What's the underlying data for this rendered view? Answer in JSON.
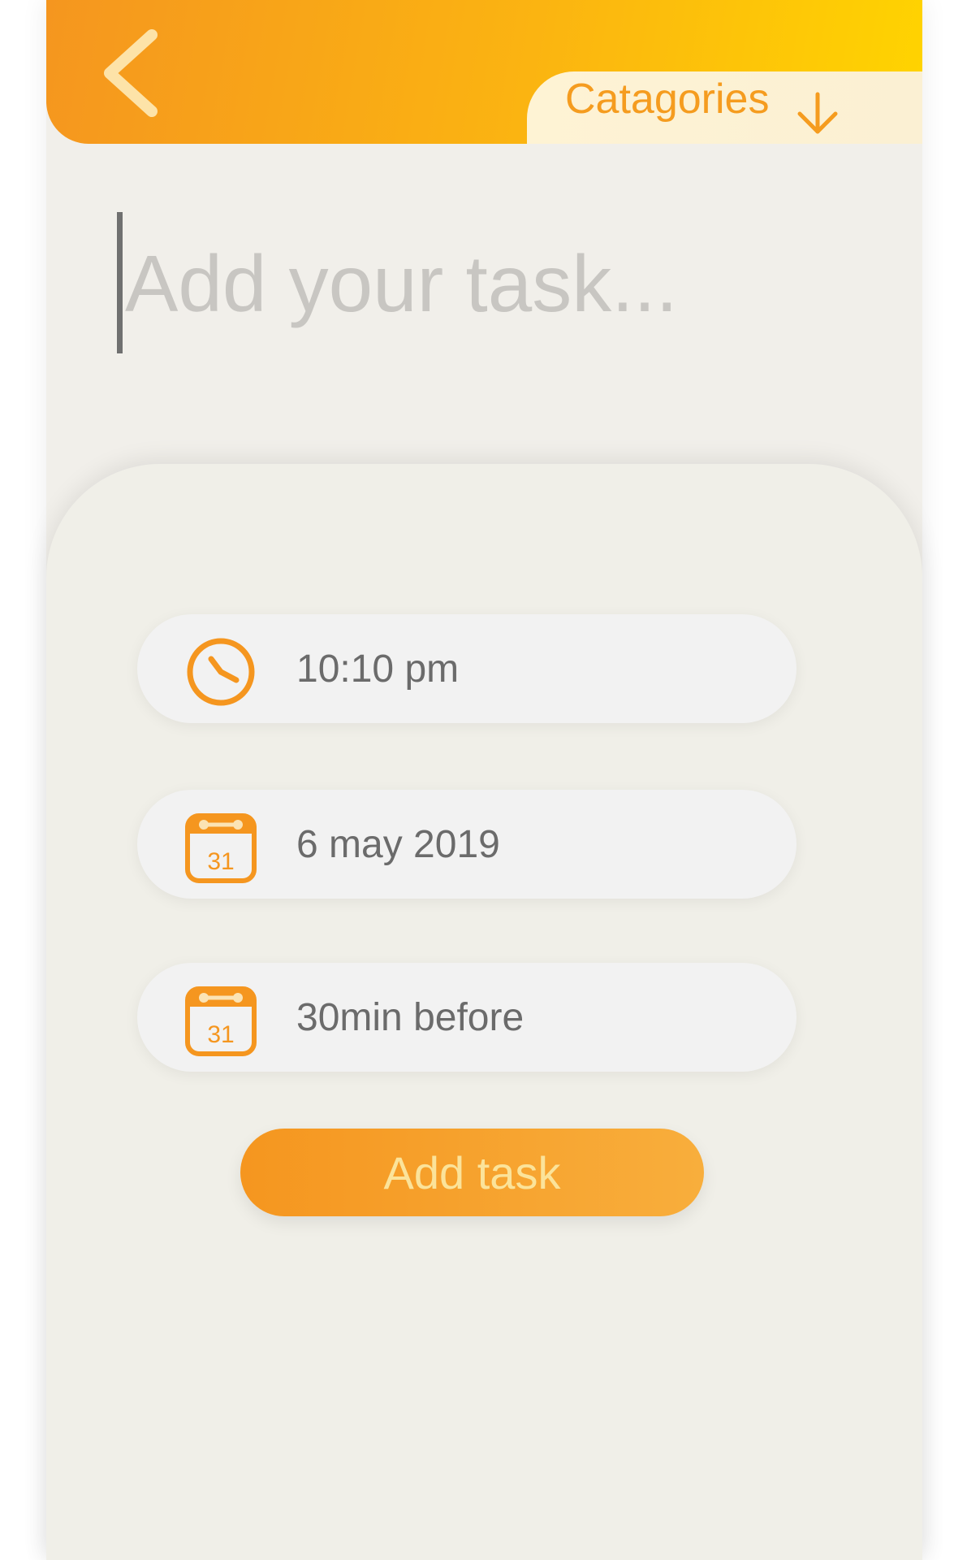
{
  "header": {
    "back_icon": "chevron-left-icon",
    "categories_label": "Catagories",
    "categories_icon": "arrow-down-icon",
    "gradient_start": "#f5961f",
    "gradient_end": "#ffd400"
  },
  "task_input": {
    "placeholder": "Add your task...",
    "value": ""
  },
  "options": {
    "time": {
      "icon": "clock-icon",
      "label": "10:10 pm"
    },
    "date": {
      "icon": "calendar-icon",
      "icon_text": "31",
      "label": "6 may 2019"
    },
    "reminder": {
      "icon": "calendar-icon",
      "icon_text": "31",
      "label": "30min before"
    }
  },
  "add_button": {
    "label": "Add task"
  },
  "colors": {
    "accent": "#f5961f",
    "text": "#6b6b6b",
    "placeholder": "#c8c6c2",
    "background": "#f1efea"
  }
}
